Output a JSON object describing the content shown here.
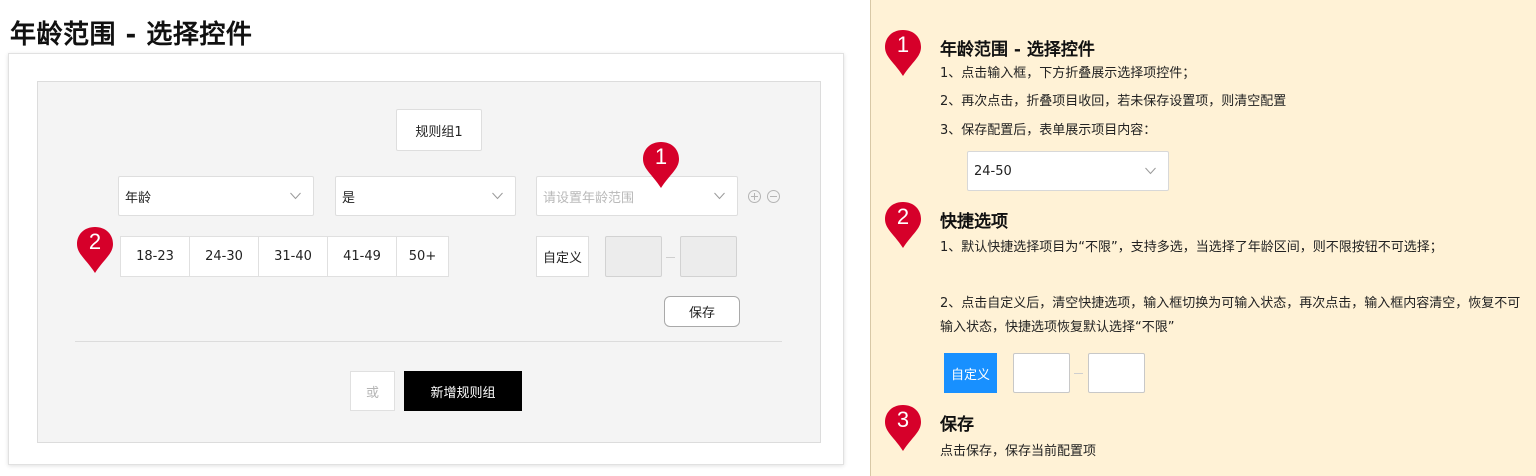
{
  "page": {
    "title": "年龄范围 - 选择控件"
  },
  "form": {
    "rule_group_tab": "规则组1",
    "field_select": "年龄",
    "operator_select": "是",
    "range_placeholder": "请设置年龄范围",
    "quick_options": [
      "18-23",
      "24-30",
      "31-40",
      "41-49",
      "50+"
    ],
    "custom_label": "自定义",
    "save_label": "保存",
    "or_label": "或",
    "add_group_label": "新增规则组"
  },
  "markers": {
    "m1": "1",
    "m2": "2",
    "m3": "3"
  },
  "panel": {
    "s1": {
      "title": "年龄范围 - 选择控件",
      "lines": [
        "1、点击输入框，下方折叠展示选择项控件；",
        "2、再次点击，折叠项目收回，若未保存设置项，则清空配置",
        "3、保存配置后，表单展示项目内容："
      ],
      "example_value": "24-50"
    },
    "s2": {
      "title": "快捷选项",
      "lines": [
        "1、默认快捷选择项目为“不限”，支持多选，当选择了年龄区间，则不限按钮不可选择；",
        "2、点击自定义后，清空快捷选项，输入框切换为可输入状态，再次点击，输入框内容清空，恢复不可输入状态，快捷选项恢复默认选择“不限”"
      ],
      "custom_label": "自定义"
    },
    "s3": {
      "title": "保存",
      "lines": [
        "点击保存，保存当前配置项"
      ]
    }
  },
  "colors": {
    "marker_red": "#d6002a",
    "panel_bg": "#fff2d6",
    "custom_blue": "#1890ff",
    "primary_black": "#000000"
  }
}
